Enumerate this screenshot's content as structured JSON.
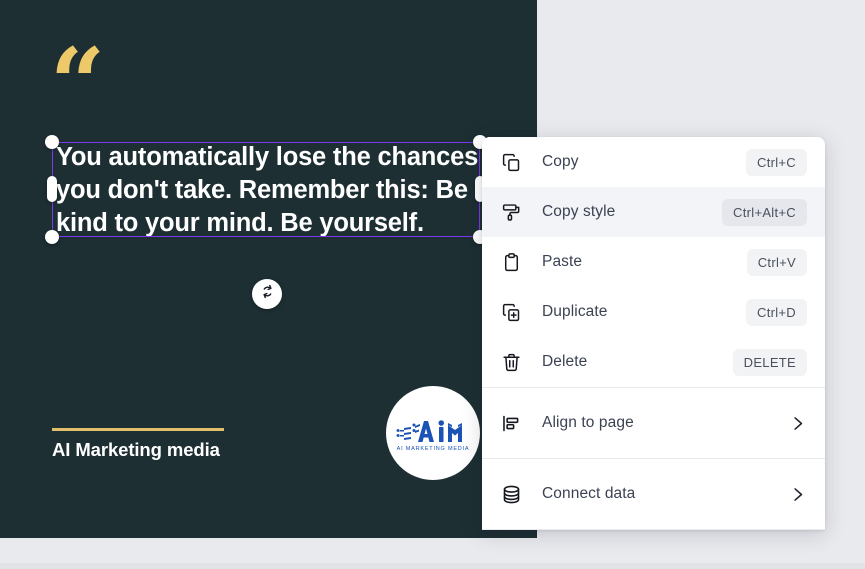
{
  "canvas": {
    "background_color": "#1d2f33",
    "quote_mark": "“",
    "quote_mark_color": "#edc969",
    "quote_text": "You automatically lose the chances you don't take. Remember this: Be kind to your mind. Be yourself.",
    "brand_name": "AI Marketing media",
    "brand_rule_color": "#e0bf6a",
    "logo": {
      "mark_text": "AiM",
      "caption": "AI MARKETING MEDIA",
      "color": "#1b52b5"
    },
    "selection": {
      "outline_color": "#7c3aed",
      "handle_color": "#ffffff",
      "rotate_icon": "rotate-icon"
    }
  },
  "workspace": {
    "background_color": "#e9eaee"
  },
  "context_menu": {
    "items": [
      {
        "label": "Copy",
        "shortcut": "Ctrl+C",
        "icon": "copy-icon",
        "hovered": false,
        "submenu": false
      },
      {
        "label": "Copy style",
        "shortcut": "Ctrl+Alt+C",
        "icon": "paint-roller-icon",
        "hovered": true,
        "submenu": false
      },
      {
        "label": "Paste",
        "shortcut": "Ctrl+V",
        "icon": "clipboard-icon",
        "hovered": false,
        "submenu": false
      },
      {
        "label": "Duplicate",
        "shortcut": "Ctrl+D",
        "icon": "duplicate-icon",
        "hovered": false,
        "submenu": false
      },
      {
        "label": "Delete",
        "shortcut": "DELETE",
        "icon": "trash-icon",
        "hovered": false,
        "submenu": false
      }
    ],
    "submenu_items": [
      {
        "label": "Align to page",
        "icon": "align-icon",
        "chevron": "›"
      },
      {
        "label": "Connect data",
        "icon": "database-icon",
        "chevron": "›"
      }
    ]
  }
}
